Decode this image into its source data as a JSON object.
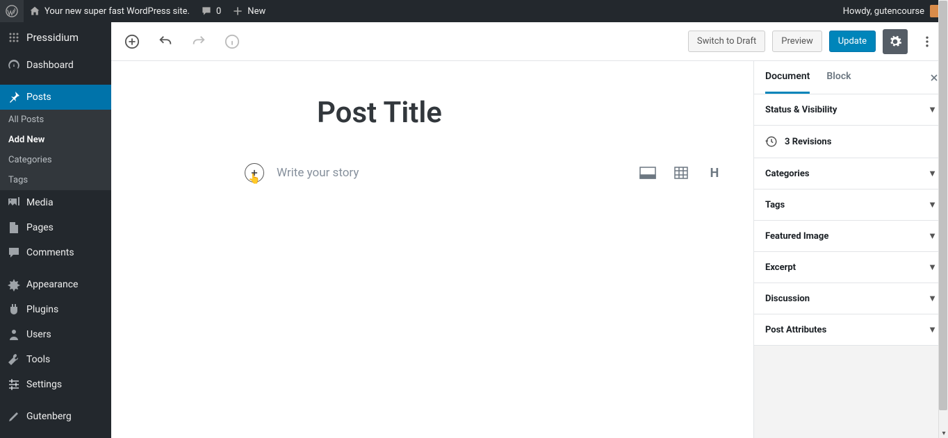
{
  "adminbar": {
    "site_title": "Your new super fast WordPress site.",
    "comments_count": "0",
    "new_label": "New",
    "howdy": "Howdy, gutencourse"
  },
  "sidebar": {
    "brand": "Pressidium",
    "items": [
      {
        "label": "Dashboard"
      },
      {
        "label": "Posts"
      },
      {
        "label": "Media"
      },
      {
        "label": "Pages"
      },
      {
        "label": "Comments"
      },
      {
        "label": "Appearance"
      },
      {
        "label": "Plugins"
      },
      {
        "label": "Users"
      },
      {
        "label": "Tools"
      },
      {
        "label": "Settings"
      },
      {
        "label": "Gutenberg"
      }
    ],
    "posts_submenu": {
      "all": "All Posts",
      "add": "Add New",
      "cat": "Categories",
      "tags": "Tags"
    }
  },
  "toolbar": {
    "switch_draft": "Switch to Draft",
    "preview": "Preview",
    "update": "Update"
  },
  "editor": {
    "title": "Post Title",
    "placeholder": "Write your story"
  },
  "settings": {
    "tabs": {
      "doc": "Document",
      "block": "Block"
    },
    "panels": {
      "status": "Status & Visibility",
      "revisions": "3 Revisions",
      "categories": "Categories",
      "tags": "Tags",
      "featured": "Featured Image",
      "excerpt": "Excerpt",
      "discussion": "Discussion",
      "attributes": "Post Attributes"
    }
  }
}
